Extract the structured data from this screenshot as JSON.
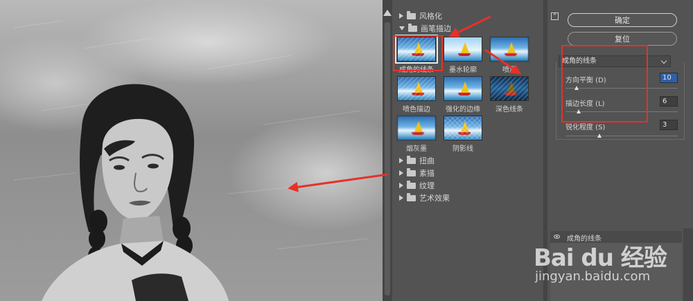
{
  "filter_gallery": {
    "categories": [
      {
        "label": "风格化",
        "expanded": false
      },
      {
        "label": "画笔描边",
        "expanded": true
      },
      {
        "label": "扭曲",
        "expanded": false
      },
      {
        "label": "素描",
        "expanded": false
      },
      {
        "label": "纹理",
        "expanded": false
      },
      {
        "label": "艺术效果",
        "expanded": false
      }
    ],
    "brush_strokes": [
      {
        "label": "成角的线条",
        "selected": true
      },
      {
        "label": "墨水轮廓",
        "selected": false
      },
      {
        "label": "喷溅",
        "selected": false
      },
      {
        "label": "喷色描边",
        "selected": false
      },
      {
        "label": "强化的边缘",
        "selected": false
      },
      {
        "label": "深色线条",
        "selected": false
      },
      {
        "label": "烟灰墨",
        "selected": false
      },
      {
        "label": "阴影线",
        "selected": false
      }
    ]
  },
  "settings": {
    "ok_label": "确定",
    "reset_label": "复位",
    "filter_dropdown": "成角的线条",
    "params": [
      {
        "label": "方向平衡 (D)",
        "value": "10",
        "max": 100
      },
      {
        "label": "描边长度 (L)",
        "value": "6",
        "max": 50
      },
      {
        "label": "锐化程度 (S)",
        "value": "3",
        "max": 10
      }
    ],
    "effect_layer": "成角的线条"
  },
  "watermark": {
    "logo": "Bai du 经验",
    "url": "jingyan.baidu.com"
  },
  "colors": {
    "annotation_red": "#e8302a",
    "panel_bg": "#535353",
    "value_highlight": "#2f5fa8"
  }
}
